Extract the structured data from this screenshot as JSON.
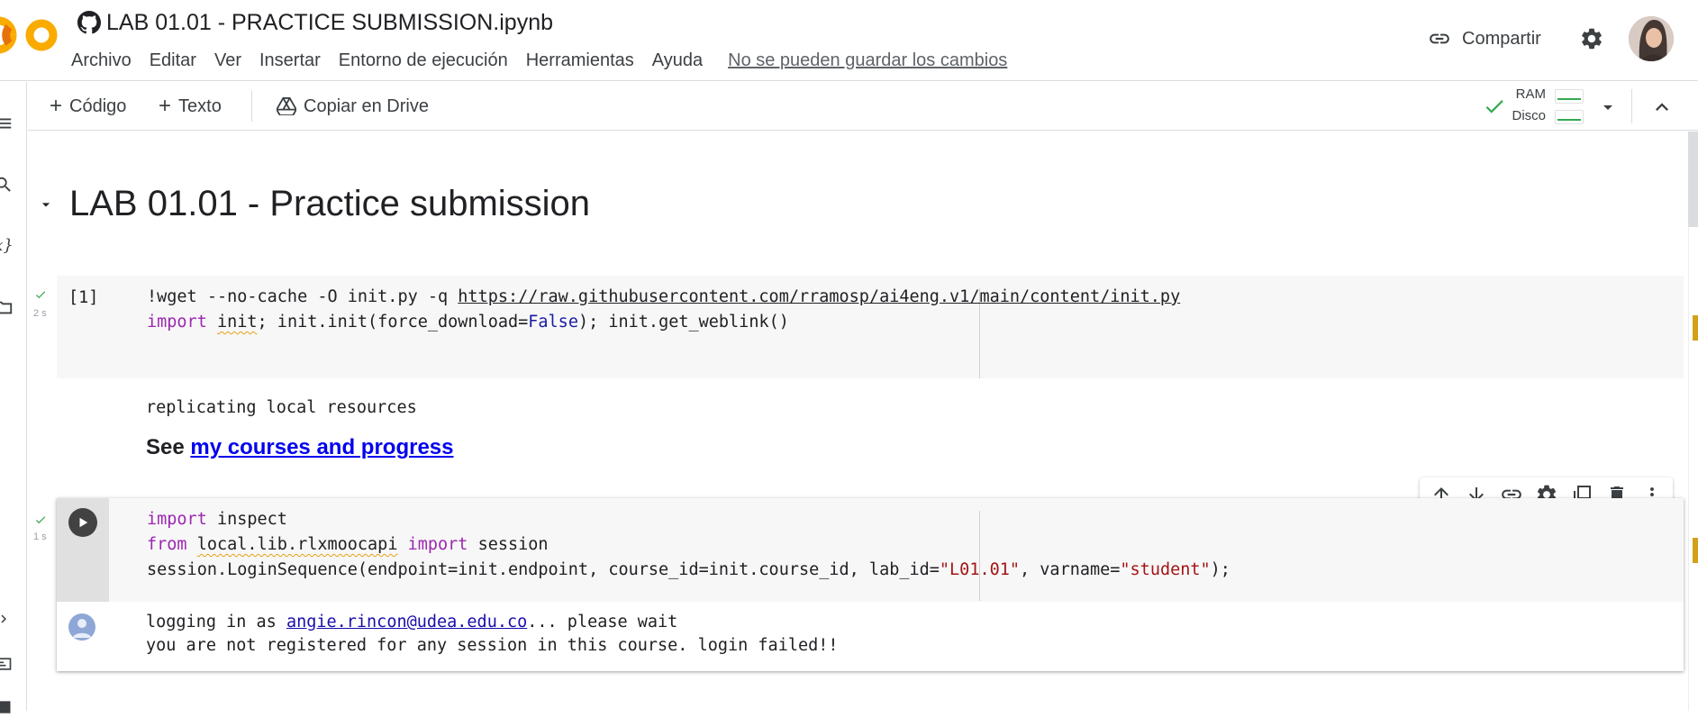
{
  "header": {
    "title": "LAB 01.01 - PRACTICE SUBMISSION.ipynb",
    "menu": [
      "Archivo",
      "Editar",
      "Ver",
      "Insertar",
      "Entorno de ejecución",
      "Herramientas",
      "Ayuda"
    ],
    "save_warning": "No se pueden guardar los cambios",
    "share_label": "Compartir"
  },
  "toolbar": {
    "add_code": "Código",
    "add_text": "Texto",
    "copy_drive": "Copiar en Drive",
    "ram_label": "RAM",
    "disk_label": "Disco"
  },
  "notebook": {
    "heading": "LAB 01.01 - Practice submission",
    "cell1": {
      "exec_count": "[1]",
      "time": "2 s",
      "line1_cmd": "!wget --no-cache -O init.py -q ",
      "line1_url": "https://raw.githubusercontent.com/rramosp/ai4eng.v1/main/content/init.py",
      "line2_kw": "import",
      "line2_mod": "init",
      "line2_mid": "; init.init(force_download=",
      "line2_bool": "False",
      "line2_end": "); init.get_weblink()",
      "output_text": "replicating local resources",
      "output_see": "See ",
      "output_link": "my courses and progress"
    },
    "cell2": {
      "time": "1 s",
      "line1_kw": "import",
      "line1_rest": " inspect",
      "line2_kw1": "from",
      "line2_mod": "local.lib.rlxmoocapi",
      "line2_kw2": "import",
      "line2_rest": " session",
      "line3_a": "session.LoginSequence(endpoint=init.endpoint, course_id=init.course_id, lab_id=",
      "line3_str1": "\"L01.01\"",
      "line3_b": ", varname=",
      "line3_str2": "\"student\"",
      "line3_c": ");",
      "out1_a": "logging in as ",
      "out1_link": "angie.rincon@udea.edu.co",
      "out1_b": "... please wait",
      "out2": "you are not registered for any session in this course. login failed!!"
    }
  },
  "icons": {
    "github": "github-icon",
    "share": "link-icon",
    "settings": "gear-icon",
    "resource_ok": "check-icon",
    "colors": {
      "accent_orange": "#f9ab00",
      "check_green": "#34a853",
      "marker": "#d4a017"
    }
  }
}
